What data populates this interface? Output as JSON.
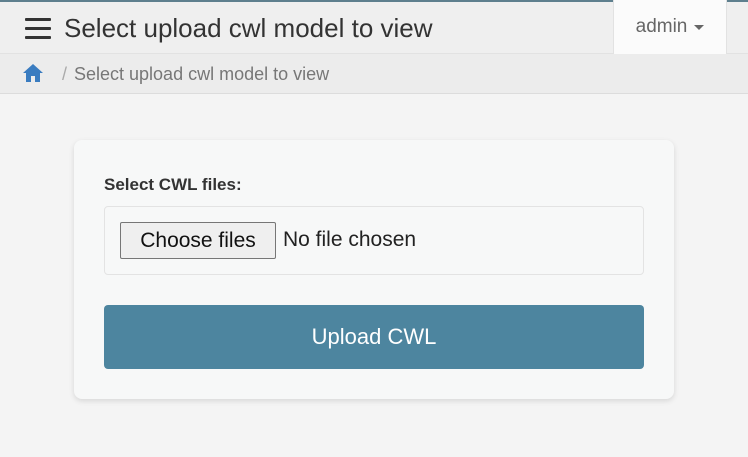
{
  "header": {
    "title": "Select upload cwl model to view",
    "user": "admin",
    "menu_icon": "hamburger-menu-icon",
    "dropdown_icon": "caret-down-icon"
  },
  "breadcrumb": {
    "home_icon": "home-icon",
    "separator": "/",
    "current": "Select upload cwl model to view"
  },
  "form": {
    "label": "Select CWL files:",
    "choose_button": "Choose files",
    "file_status": "No file chosen",
    "submit_button": "Upload CWL"
  },
  "colors": {
    "accent": "#4d859f",
    "home_icon": "#3a7cc0",
    "top_border": "#5e7f8e"
  }
}
